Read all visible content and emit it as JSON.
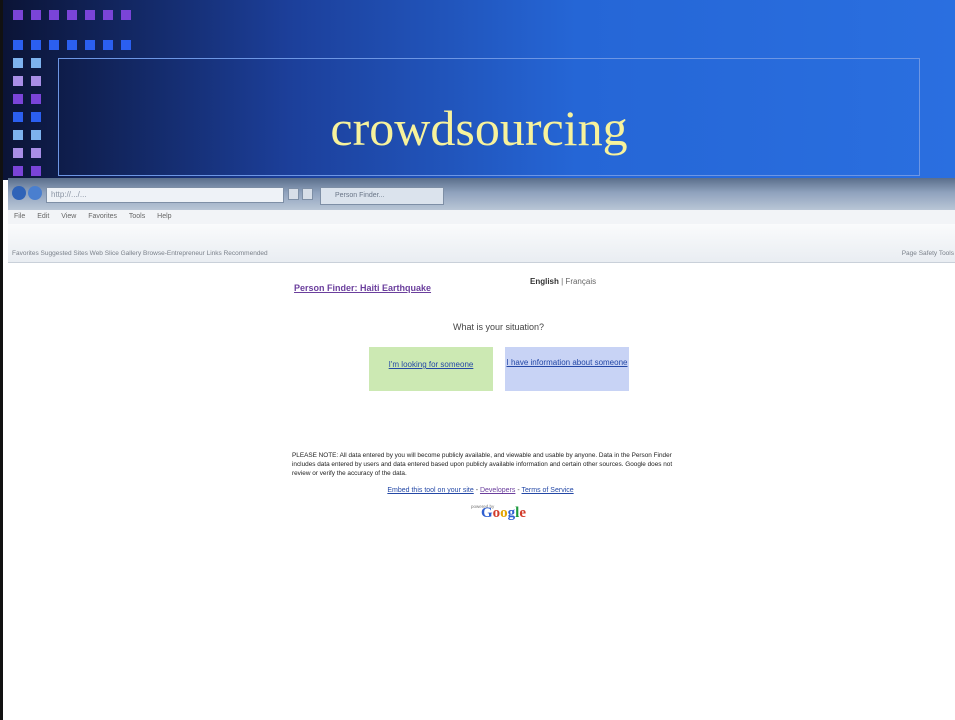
{
  "slide": {
    "title": "crowdsourcing"
  },
  "browser": {
    "address": "http://.../...",
    "tab": "Person Finder...",
    "menus": [
      "File",
      "Edit",
      "View",
      "Favorites",
      "Tools",
      "Help"
    ],
    "favorites": "Favorites  Suggested Sites  Web Slice Gallery  Browse-Entrepreneur Links  Recommended",
    "tools": "Page  Safety  Tools"
  },
  "page": {
    "site_title": "Person Finder: Haiti Earthquake",
    "language_label": "English",
    "language_value": "| Français",
    "question": "What is your situation?",
    "button_looking": "I'm looking for someone",
    "button_info": "I have information about someone",
    "notice": "PLEASE NOTE: All data entered by you will become publicly available, and viewable and usable by anyone. Data in the Person Finder includes data entered by users and data entered based upon publicly available information and certain other sources. Google does not review or verify the accuracy of the data.",
    "footer_embed": "Embed this tool on your site",
    "footer_dev": "Developers",
    "footer_terms": "Terms of Service",
    "footer_sep": " - ",
    "powered": "powered by",
    "google": "Google"
  },
  "colors": {
    "title_text": "#f7f29c",
    "header_dark": "#0b1436",
    "header_light": "#2a6fe0",
    "link_blue": "#2448a6",
    "visited_purple": "#6b3f9d",
    "green_button": "#cce9b3",
    "blue_button": "#c8d3f5"
  }
}
